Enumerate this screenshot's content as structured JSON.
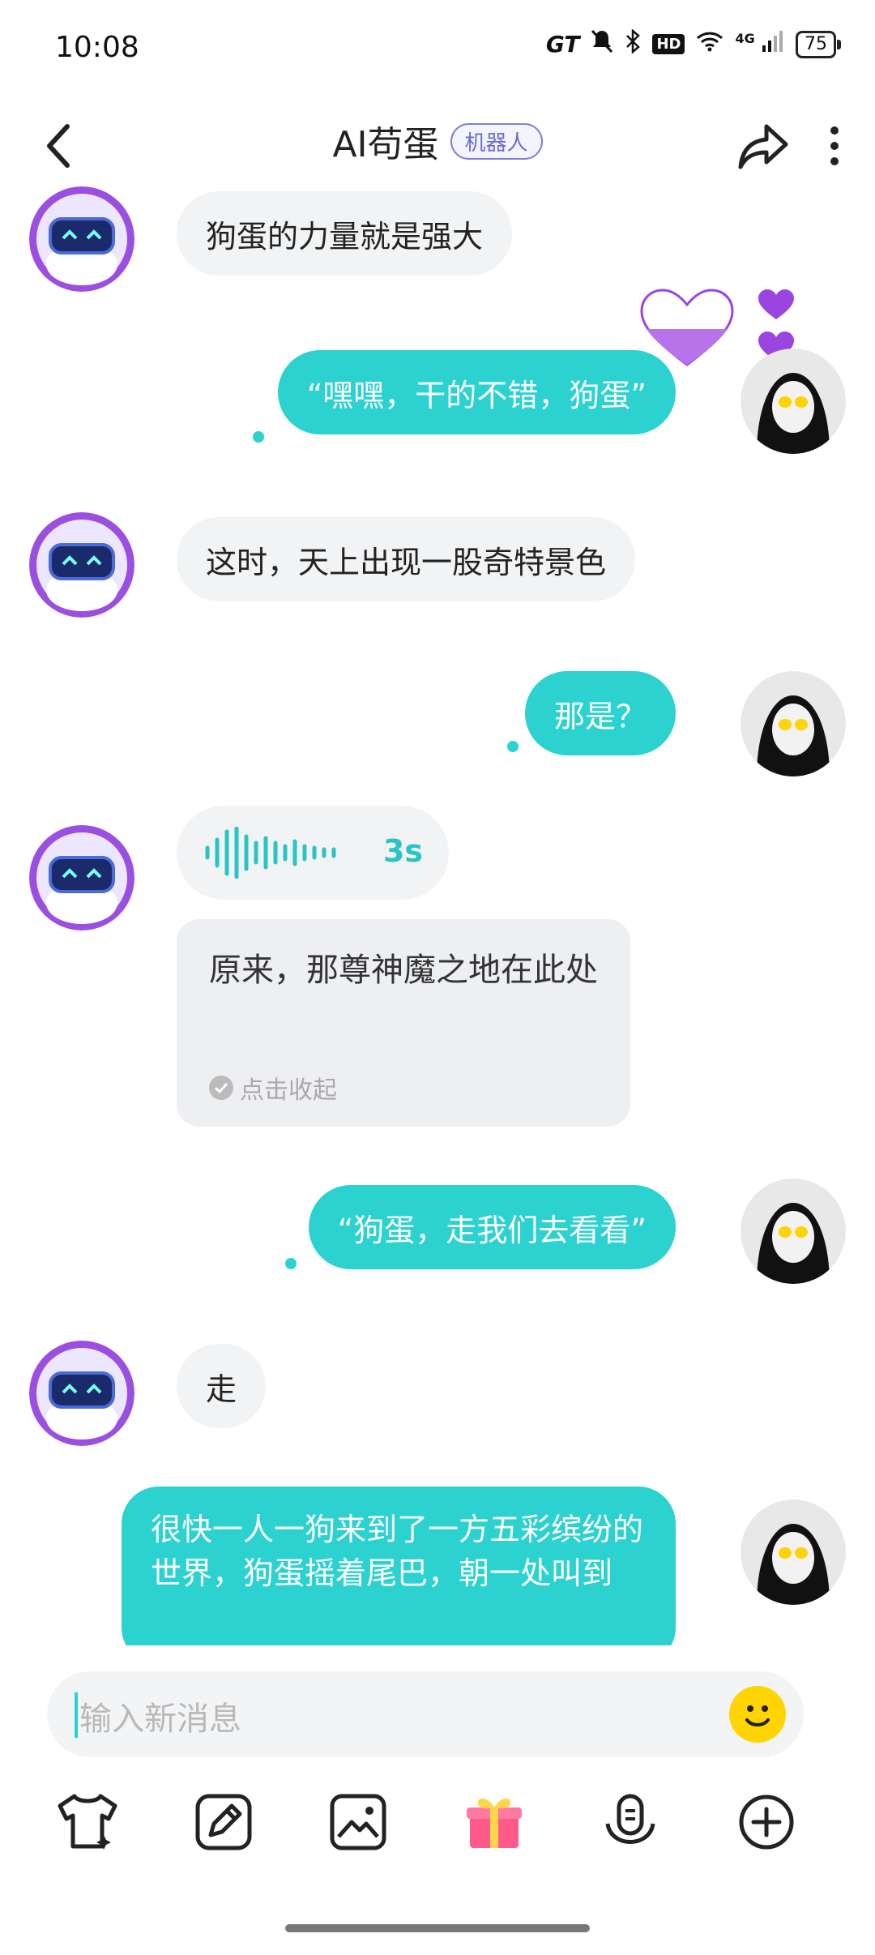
{
  "status_bar": {
    "time": "10:08",
    "network": "4G",
    "battery": "75",
    "gt": "GT",
    "hd": "HD"
  },
  "header": {
    "title": "AI苟蛋",
    "badge": "机器人"
  },
  "messages": [
    {
      "role": "bot",
      "type": "text",
      "text": "狗蛋的力量就是强大"
    },
    {
      "role": "user",
      "type": "text",
      "text": "“嘿嘿，干的不错，狗蛋”"
    },
    {
      "role": "bot",
      "type": "text",
      "text": "这时，天上出现一股奇特景色"
    },
    {
      "role": "user",
      "type": "text",
      "text": "那是？"
    },
    {
      "role": "bot",
      "type": "voice",
      "duration": "3s"
    },
    {
      "role": "bot",
      "type": "expanded_text",
      "text": "原来，那尊神魔之地在此处",
      "collapse_label": "点击收起"
    },
    {
      "role": "user",
      "type": "text",
      "text": "“狗蛋，走我们去看看”"
    },
    {
      "role": "bot",
      "type": "text",
      "text": "走"
    },
    {
      "role": "user",
      "type": "text",
      "text": "很快一人一狗来到了一方五彩缤纷的世界，狗蛋摇着尾巴，朝一处叫到"
    }
  ],
  "input": {
    "placeholder": "输入新消息"
  },
  "toolbar": [
    "outfit-icon",
    "edit-icon",
    "image-icon",
    "gift-icon",
    "voice-icon",
    "add-icon"
  ],
  "colors": {
    "accent": "#2bd2cf",
    "bot_bubble": "#f2f3f5",
    "heart": "#9b45e0",
    "badge": "#6b6bd4"
  }
}
